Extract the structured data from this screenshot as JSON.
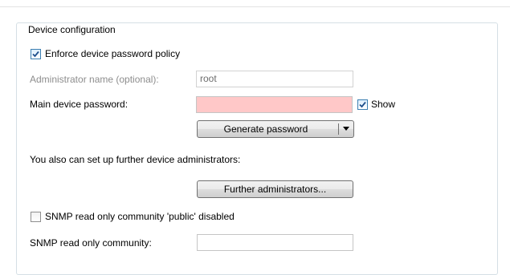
{
  "group": {
    "title": "Device configuration"
  },
  "enforce_policy": {
    "label": "Enforce device password policy",
    "checked": true
  },
  "admin_name": {
    "label": "Administrator name (optional):",
    "value": "root"
  },
  "main_password": {
    "label": "Main device password:",
    "value": ""
  },
  "show": {
    "label": "Show",
    "checked": true
  },
  "generate": {
    "label": "Generate password"
  },
  "further_admins": {
    "text": "You also can set up further device administrators:",
    "button_label": "Further administrators..."
  },
  "snmp_public": {
    "label": "SNMP read only community 'public' disabled",
    "checked": false
  },
  "snmp_community": {
    "label": "SNMP read only community:",
    "value": ""
  }
}
